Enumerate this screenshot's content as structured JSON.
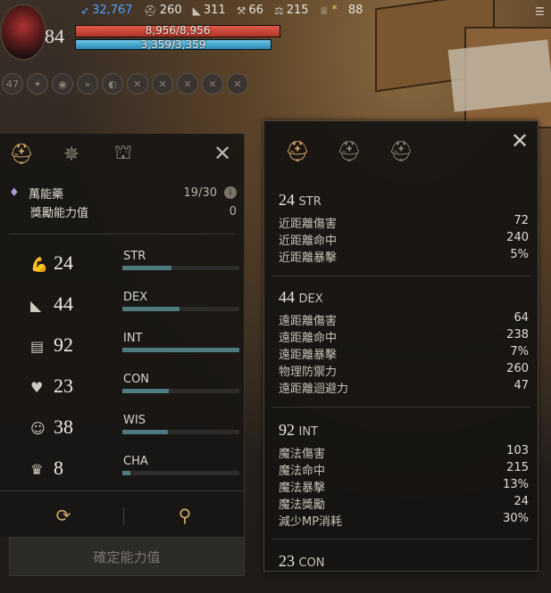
{
  "hud": {
    "level": "84",
    "resources": [
      {
        "icon": "feather-icon",
        "value": "32,767",
        "color": "#4ea3ff"
      },
      {
        "icon": "helmet-icon",
        "value": "260"
      },
      {
        "icon": "boot-icon",
        "value": "311"
      },
      {
        "icon": "wrench-icon",
        "value": "66"
      },
      {
        "icon": "weight-icon",
        "value": "215"
      },
      {
        "icon": "trophy-icon",
        "value": "*"
      },
      {
        "icon": "star-icon",
        "value": "88"
      }
    ],
    "hp_label": "8,956/8,956",
    "mp_label": "3,359/3,359",
    "buff_first": "47"
  },
  "left_panel": {
    "potion_name": "萬能藥",
    "potion_count": "19/30",
    "bonus_label": "獎勵能力值",
    "bonus_value": "0",
    "stats": [
      {
        "icon": "arm-icon",
        "value": "24",
        "name": "STR",
        "fill": 0.42
      },
      {
        "icon": "boot-icon",
        "value": "44",
        "name": "DEX",
        "fill": 0.49
      },
      {
        "icon": "book-icon",
        "value": "92",
        "name": "INT",
        "fill": 1.0
      },
      {
        "icon": "heart-icon",
        "value": "23",
        "name": "CON",
        "fill": 0.4
      },
      {
        "icon": "head-icon",
        "value": "38",
        "name": "WIS",
        "fill": 0.39
      },
      {
        "icon": "crown-icon",
        "value": "8",
        "name": "CHA",
        "fill": 0.07
      }
    ],
    "confirm_label": "確定能力值"
  },
  "right_panel": {
    "sections": [
      {
        "value": "24",
        "abbr": "STR",
        "rows": [
          {
            "label": "近距離傷害",
            "value": "72"
          },
          {
            "label": "近距離命中",
            "value": "240"
          },
          {
            "label": "近距離暴擊",
            "value": "5%"
          }
        ]
      },
      {
        "value": "44",
        "abbr": "DEX",
        "rows": [
          {
            "label": "遠距離傷害",
            "value": "64"
          },
          {
            "label": "遠距離命中",
            "value": "238"
          },
          {
            "label": "遠距離暴擊",
            "value": "7%"
          },
          {
            "label": "物理防禦力",
            "value": "260"
          },
          {
            "label": "遠距離迴避力",
            "value": "47"
          }
        ]
      },
      {
        "value": "92",
        "abbr": "INT",
        "rows": [
          {
            "label": "魔法傷害",
            "value": "103"
          },
          {
            "label": "魔法命中",
            "value": "215"
          },
          {
            "label": "魔法暴擊",
            "value": "13%"
          },
          {
            "label": "魔法獎勵",
            "value": "24"
          },
          {
            "label": "減少MP消耗",
            "value": "30%"
          }
        ]
      },
      {
        "value": "23",
        "abbr": "CON",
        "rows": []
      }
    ]
  }
}
